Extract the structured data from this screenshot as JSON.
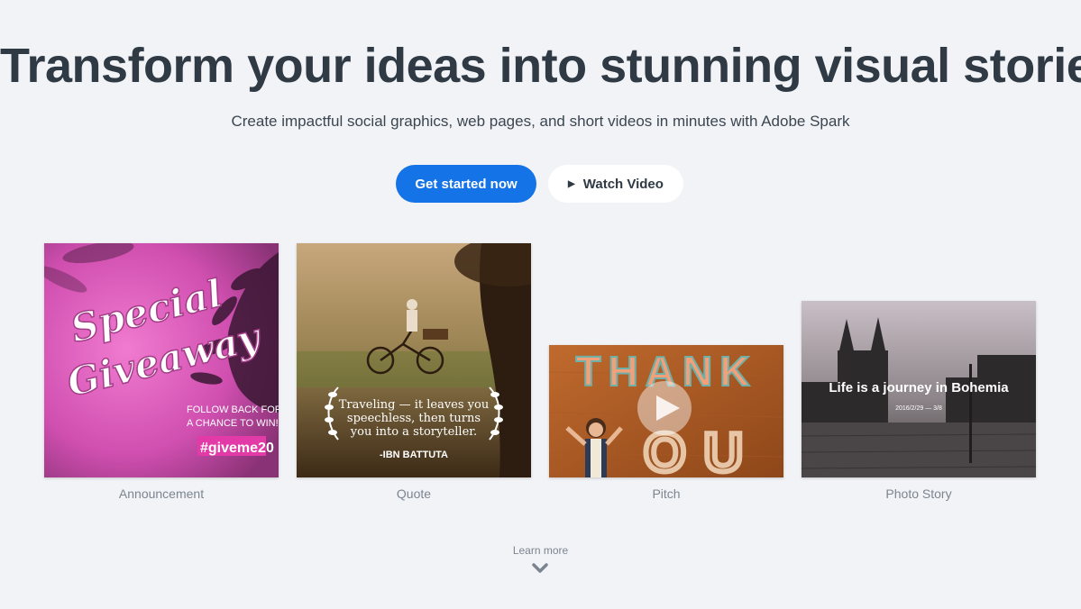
{
  "hero": {
    "headline": "Transform your ideas into stunning visual stories",
    "subheadline": "Create impactful social graphics, web pages, and short videos in minutes with Adobe Spark"
  },
  "cta": {
    "primary_label": "Get started now",
    "secondary_label": "Watch Video",
    "secondary_icon": "play-icon"
  },
  "cards": [
    {
      "caption": "Announcement",
      "overlay_title_line1": "Special",
      "overlay_title_line2": "Giveaway",
      "overlay_line1": "FOLLOW BACK FOR",
      "overlay_line2": "A CHANCE TO WIN!",
      "overlay_tag": "#giveme20"
    },
    {
      "caption": "Quote",
      "quote_line1": "Traveling — it leaves you",
      "quote_line2": "speechless, then turns",
      "quote_line3": "you into a storyteller.",
      "quote_author": "-IBN BATTUTA"
    },
    {
      "caption": "Pitch",
      "letters_top": "THANK",
      "letters_bottom": "OU"
    },
    {
      "caption": "Photo Story",
      "overlay_title": "Life is a journey in Bohemia",
      "overlay_date": "2016/2/29 — 3/8"
    }
  ],
  "learn_more": {
    "label": "Learn more",
    "icon": "chevron-down-icon"
  },
  "colors": {
    "background": "#f2f3f6",
    "primary": "#1473e6",
    "text": "#2f3a45"
  }
}
